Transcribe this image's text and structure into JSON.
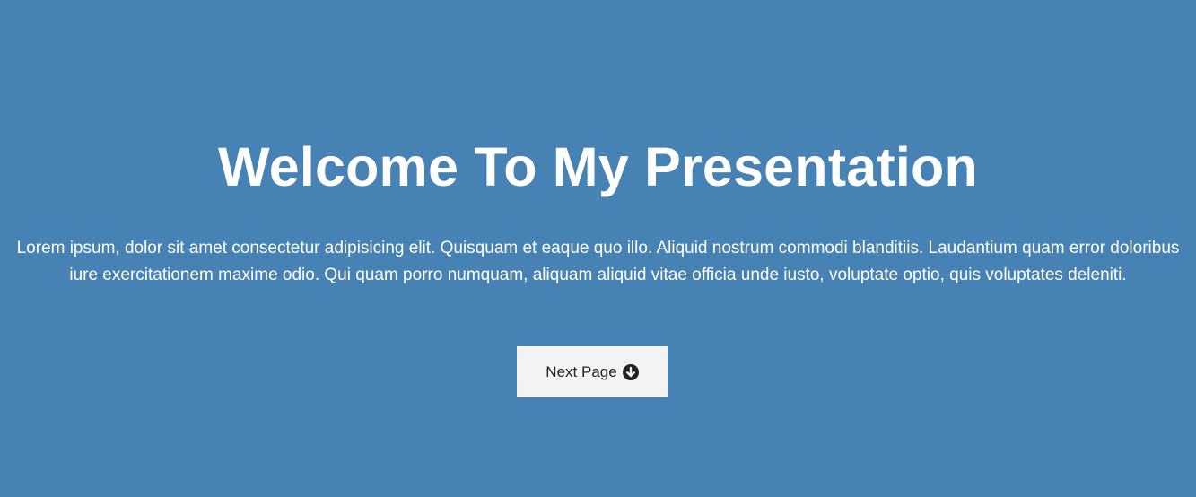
{
  "hero": {
    "title": "Welcome To My Presentation",
    "body": "Lorem ipsum, dolor sit amet consectetur adipisicing elit. Quisquam et eaque quo illo. Aliquid nostrum commodi blanditiis. Laudantium quam error doloribus iure exercitationem maxime odio. Qui quam porro numquam, aliquam aliquid vitae officia unde iusto, voluptate optio, quis voluptates deleniti.",
    "button_label": "Next Page",
    "button_icon": "arrow-circle-down-icon"
  },
  "colors": {
    "background": "#4682b4",
    "text": "#ffffff",
    "button_bg": "#f3f3f3",
    "button_text": "#222222"
  }
}
